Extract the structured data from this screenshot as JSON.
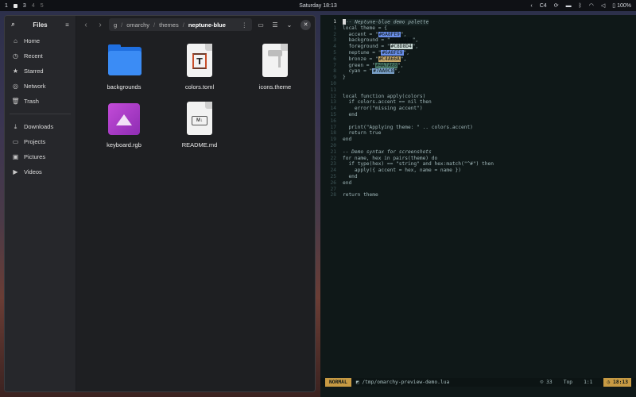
{
  "topbar": {
    "workspaces": [
      "1",
      "3",
      "4",
      "5"
    ],
    "clock": "Saturday 18:13",
    "tray": {
      "lang": "C4",
      "battery": "100%"
    }
  },
  "files": {
    "title": "Files",
    "sidebar": [
      {
        "label": "Home",
        "icon": "home-icon",
        "glyph": "⌂"
      },
      {
        "label": "Recent",
        "icon": "clock-icon",
        "glyph": "◷"
      },
      {
        "label": "Starred",
        "icon": "star-icon",
        "glyph": "★"
      },
      {
        "label": "Network",
        "icon": "network-icon",
        "glyph": "◎"
      },
      {
        "label": "Trash",
        "icon": "trash-icon",
        "glyph": "🗑"
      },
      {
        "label": "Downloads",
        "icon": "download-icon",
        "glyph": "⤓"
      },
      {
        "label": "Projects",
        "icon": "folder-icon",
        "glyph": "▭"
      },
      {
        "label": "Pictures",
        "icon": "picture-icon",
        "glyph": "▣"
      },
      {
        "label": "Videos",
        "icon": "video-icon",
        "glyph": "▶"
      }
    ],
    "breadcrumb": {
      "first": "g",
      "second": "omarchy",
      "third": "themes",
      "current": "neptune-blue"
    },
    "items": [
      {
        "name": "backgrounds",
        "kind": "folder"
      },
      {
        "name": "colors.toml",
        "kind": "toml"
      },
      {
        "name": "icons.theme",
        "kind": "theme"
      },
      {
        "name": "keyboard.rgb",
        "kind": "image"
      },
      {
        "name": "README.md",
        "kind": "markdown"
      }
    ]
  },
  "editor": {
    "lines": [
      {
        "n": "1",
        "t": "-- Neptune-blue demo palette",
        "type": "comment"
      },
      {
        "n": "1",
        "t": "local theme = {",
        "type": "code"
      },
      {
        "n": "2",
        "t": "  accent = \"#6A8FE9\",",
        "type": "code"
      },
      {
        "n": "3",
        "t": "  background = \"#081012\",",
        "type": "code"
      },
      {
        "n": "4",
        "t": "  foreground = \"#C8D8D4\",",
        "type": "code"
      },
      {
        "n": "5",
        "t": "  neptune = \"#6A8FE9\",",
        "type": "code"
      },
      {
        "n": "6",
        "t": "  bronze = \"#C4A66A\",",
        "type": "code"
      },
      {
        "n": "7",
        "t": "  green = \"#4A7A68\",",
        "type": "code"
      },
      {
        "n": "8",
        "t": "  cyan = \"#7AA0C8\",",
        "type": "code"
      },
      {
        "n": "9",
        "t": "}",
        "type": "code"
      },
      {
        "n": "10",
        "t": "",
        "type": "code"
      },
      {
        "n": "11",
        "t": "",
        "type": "code"
      },
      {
        "n": "12",
        "t": "local function apply(colors)",
        "type": "code"
      },
      {
        "n": "13",
        "t": "  if colors.accent == nil then",
        "type": "code"
      },
      {
        "n": "14",
        "t": "    error(\"missing accent\")",
        "type": "code"
      },
      {
        "n": "15",
        "t": "  end",
        "type": "code"
      },
      {
        "n": "16",
        "t": "",
        "type": "code"
      },
      {
        "n": "17",
        "t": "  print(\"Applying theme: \" .. colors.accent)",
        "type": "code"
      },
      {
        "n": "18",
        "t": "  return true",
        "type": "code"
      },
      {
        "n": "19",
        "t": "end",
        "type": "code"
      },
      {
        "n": "20",
        "t": "",
        "type": "code"
      },
      {
        "n": "21",
        "t": "-- Demo syntax for screenshots",
        "type": "comment"
      },
      {
        "n": "22",
        "t": "for name, hex in pairs(theme) do",
        "type": "code"
      },
      {
        "n": "23",
        "t": "  if type(hex) == \"string\" and hex:match(\"^#\") then",
        "type": "code"
      },
      {
        "n": "24",
        "t": "    apply({ accent = hex, name = name })",
        "type": "code"
      },
      {
        "n": "25",
        "t": "  end",
        "type": "code"
      },
      {
        "n": "26",
        "t": "end",
        "type": "code"
      },
      {
        "n": "27",
        "t": "",
        "type": "code"
      },
      {
        "n": "28",
        "t": "return theme",
        "type": "code"
      }
    ],
    "status": {
      "mode": "NORMAL",
      "path": "/tmp/omarchy-preview-demo.lua",
      "count": "33",
      "pos": "Top",
      "cursor": "1:1",
      "time": "18:13"
    }
  },
  "colors": {
    "accent": "#c79a43",
    "folder": "#3b8cf5",
    "term_bg": "#0f1818"
  }
}
